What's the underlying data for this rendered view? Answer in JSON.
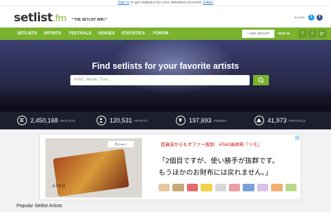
{
  "topbar": {
    "link": "Sign in",
    "text": " to get statistics for your attended concerts! ",
    "hide": "(Hide)"
  },
  "header": {
    "logo_main": "setlist",
    "logo_fm": ".fm",
    "tagline": "* THE SETLIST WIKI *",
    "share_label": "SHARE"
  },
  "nav": {
    "items": [
      "SETLISTS",
      "ARTISTS",
      "FESTIVALS",
      "VENUES",
      "STATISTICS",
      "FORUM"
    ],
    "add_setlist": "+ ADD SETLIST",
    "sign_in": "SIGN IN",
    "social": [
      "f",
      "t",
      "g+"
    ]
  },
  "hero": {
    "title": "Find setlists for your favorite artists",
    "search_placeholder": "Artist, Venue, Tour, ..."
  },
  "stats": [
    {
      "num": "2,450,168",
      "label": "SETLISTS",
      "icon": "list-icon"
    },
    {
      "num": "120,531",
      "label": "ARTISTS",
      "icon": "person-icon"
    },
    {
      "num": "197,693",
      "label": "VENUES",
      "icon": "map-pin-icon"
    },
    {
      "num": "41,973",
      "label": "FESTIVALS",
      "icon": "tent-icon"
    }
  ],
  "ad": {
    "badge": "売上No.1",
    "brand": "ATAO",
    "line1": "百貨店からもオファー殺到　ATAO長財布『リモ』",
    "line2": "「2個目ですが、使い勝手が抜群です。",
    "line3": "もうほかのお財布には戻れません。」",
    "colors": [
      "#e8c8a0",
      "#c9a97a",
      "#e56b6b",
      "#f2d24a",
      "#d8d8d8",
      "#e8a0a0",
      "#7aa2d6",
      "#d9c0e8",
      "#f0b070",
      "#b8d88a"
    ]
  },
  "popular": "Popular Setlist Artists",
  "accent": "#7ab32e"
}
